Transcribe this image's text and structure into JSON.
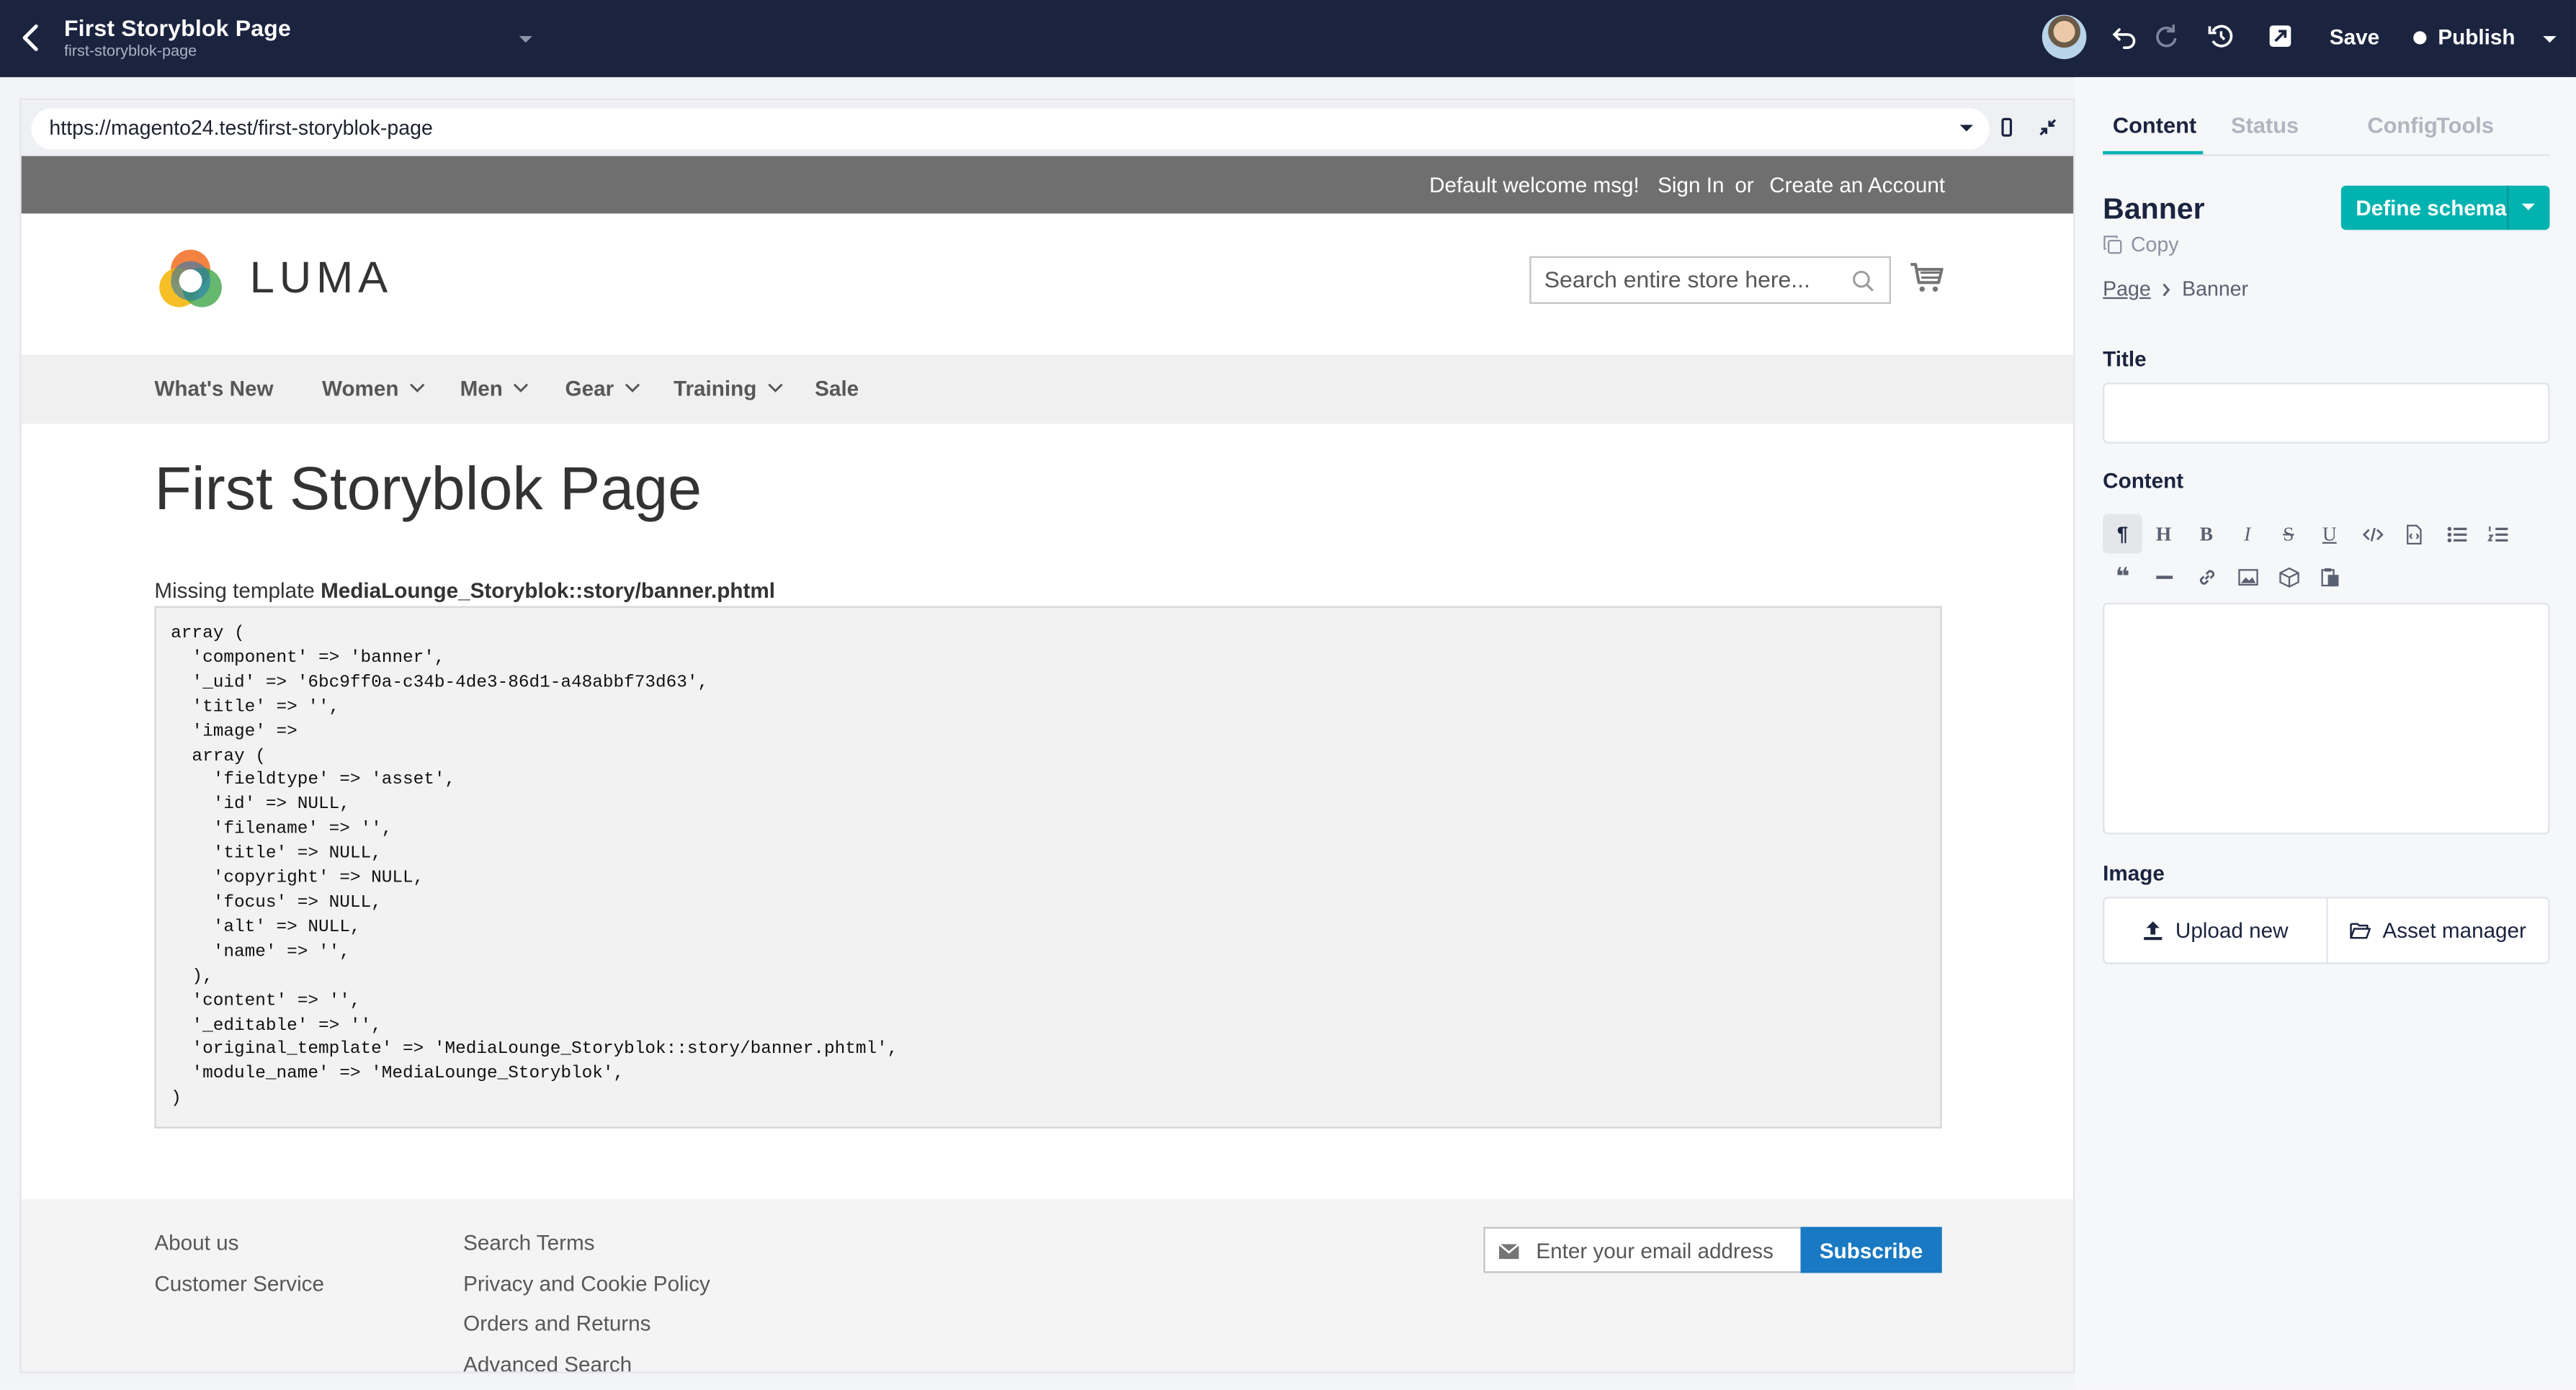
{
  "topbar": {
    "title": "First Storyblok Page",
    "slug": "first-storyblok-page",
    "save_label": "Save",
    "publish_label": "Publish"
  },
  "preview": {
    "url": "https://magento24.test/first-storyblok-page",
    "welcome": "Default welcome msg!",
    "sign_in": "Sign In",
    "or": "or",
    "create_account": "Create an Account",
    "logo_text": "LUMA",
    "search_placeholder": "Search entire store here...",
    "nav": [
      {
        "label": "What's New",
        "has_dropdown": false
      },
      {
        "label": "Women",
        "has_dropdown": true
      },
      {
        "label": "Men",
        "has_dropdown": true
      },
      {
        "label": "Gear",
        "has_dropdown": true
      },
      {
        "label": "Training",
        "has_dropdown": true
      },
      {
        "label": "Sale",
        "has_dropdown": false
      }
    ],
    "page_title": "First Storyblok Page",
    "missing_prefix": "Missing template ",
    "missing_template": "MediaLounge_Storyblok::story/banner.phtml",
    "code": "array (\n  'component' => 'banner',\n  '_uid' => '6bc9ff0a-c34b-4de3-86d1-a48abbf73d63',\n  'title' => '',\n  'image' => \n  array (\n    'fieldtype' => 'asset',\n    'id' => NULL,\n    'filename' => '',\n    'title' => NULL,\n    'copyright' => NULL,\n    'focus' => NULL,\n    'alt' => NULL,\n    'name' => '',\n  ),\n  'content' => '',\n  '_editable' => '',\n  'original_template' => 'MediaLounge_Storyblok::story/banner.phtml',\n  'module_name' => 'MediaLounge_Storyblok',\n)",
    "footer_col1": [
      "About us",
      "Customer Service"
    ],
    "footer_col2": [
      "Search Terms",
      "Privacy and Cookie Policy",
      "Orders and Returns",
      "Advanced Search"
    ],
    "newsletter_placeholder": "Enter your email address",
    "subscribe_label": "Subscribe"
  },
  "sidebar": {
    "tabs": [
      "Content",
      "Status",
      "Config",
      "Tools"
    ],
    "active_tab": "Content",
    "component_title": "Banner",
    "copy_label": "Copy",
    "define_schema_label": "Define schema",
    "breadcrumb": [
      "Page",
      "Banner"
    ],
    "title_label": "Title",
    "title_value": "",
    "content_label": "Content",
    "image_label": "Image",
    "upload_label": "Upload new",
    "asset_manager_label": "Asset manager"
  },
  "colors": {
    "topbar_bg": "#1b243f",
    "accent": "#00b3b0",
    "luma_panel": "#6f6f6f",
    "subscribe": "#1979c3"
  }
}
